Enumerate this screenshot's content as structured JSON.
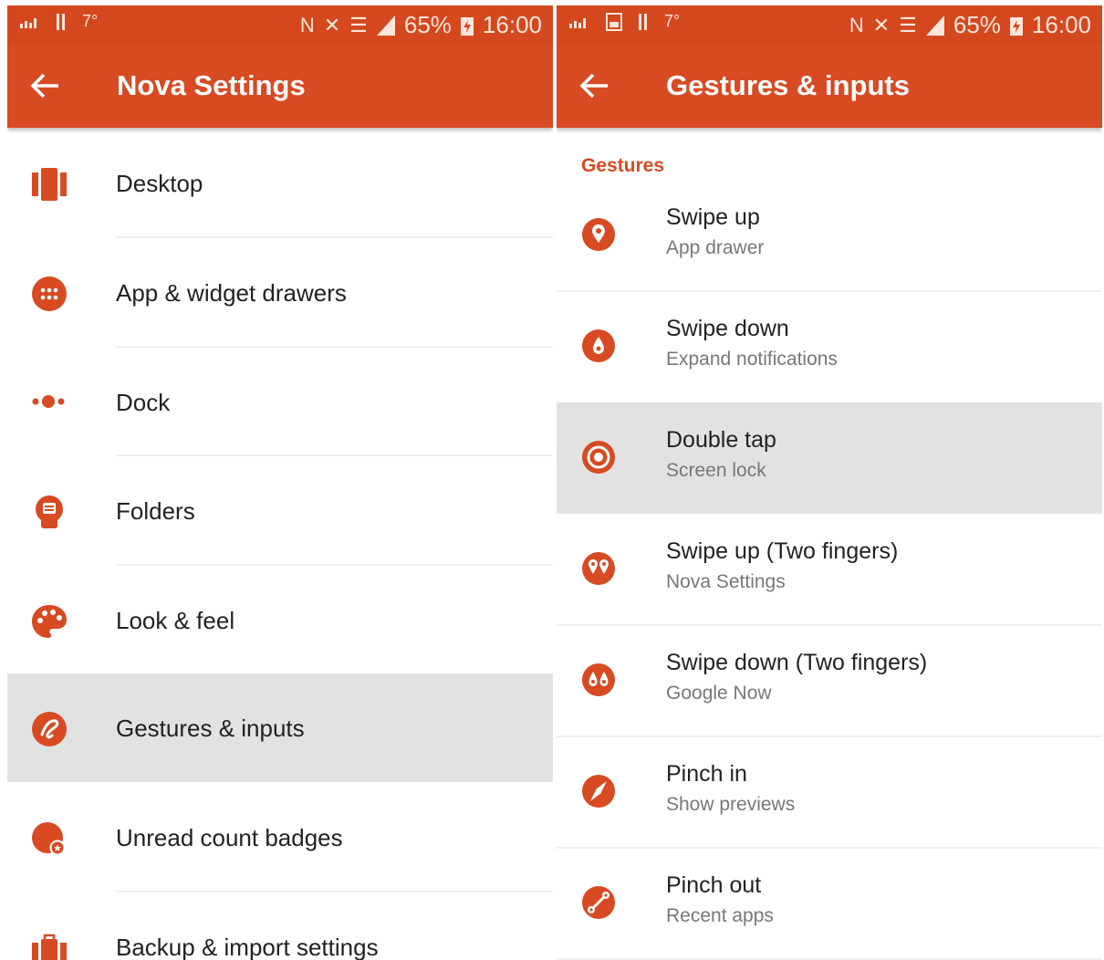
{
  "colors": {
    "accent": "#d84a22",
    "status_bar": "#d5481e",
    "selected_row": "#e2e2e2",
    "text": "#222222",
    "subtext": "#777777"
  },
  "status_bar": {
    "temperature": "7°",
    "battery": "65%",
    "time": "16:00"
  },
  "left_screen": {
    "back_icon": "arrow-back-icon",
    "title": "Nova Settings",
    "items": [
      {
        "label": "Desktop",
        "icon": "desktop-icon"
      },
      {
        "label": "App & widget drawers",
        "icon": "app-drawer-icon"
      },
      {
        "label": "Dock",
        "icon": "dock-icon"
      },
      {
        "label": "Folders",
        "icon": "folder-icon"
      },
      {
        "label": "Look & feel",
        "icon": "palette-icon"
      },
      {
        "label": "Gestures & inputs",
        "icon": "gesture-icon",
        "selected": true
      },
      {
        "label": "Unread count badges",
        "icon": "badge-icon"
      },
      {
        "label": "Backup & import settings",
        "icon": "backup-icon"
      }
    ]
  },
  "right_screen": {
    "back_icon": "arrow-back-icon",
    "title": "Gestures & inputs",
    "section_header": "Gestures",
    "items": [
      {
        "title": "Swipe up",
        "subtitle": "App drawer",
        "icon": "swipe-up-icon"
      },
      {
        "title": "Swipe down",
        "subtitle": "Expand notifications",
        "icon": "swipe-down-icon"
      },
      {
        "title": "Double tap",
        "subtitle": "Screen lock",
        "icon": "double-tap-icon",
        "selected": true
      },
      {
        "title": "Swipe up (Two fingers)",
        "subtitle": "Nova Settings",
        "icon": "two-finger-swipe-up-icon"
      },
      {
        "title": "Swipe down (Two fingers)",
        "subtitle": "Google Now",
        "icon": "two-finger-swipe-down-icon"
      },
      {
        "title": "Pinch in",
        "subtitle": "Show previews",
        "icon": "pinch-in-icon"
      },
      {
        "title": "Pinch out",
        "subtitle": "Recent apps",
        "icon": "pinch-out-icon"
      }
    ]
  }
}
